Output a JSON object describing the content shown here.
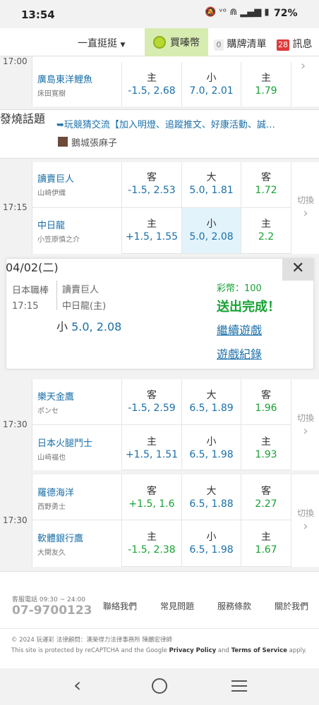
{
  "status": {
    "time": "13:54",
    "battery": "72%",
    "icons": "🔕 ᵛᵒ ⋒ ▂▄▆ ▮"
  },
  "nav": {
    "dropdown": "一直挺挺",
    "buy": "買嗪幣",
    "list_count": "0",
    "list": "購牌清單",
    "msg_count": "28",
    "msg": "訊息"
  },
  "games": [
    {
      "time": "17:00",
      "home": {
        "name": "廣島東洋鯉魚",
        "pitcher": "床田寛樹",
        "spread": {
          "side": "主",
          "line": "-1.5, 2.68"
        },
        "total": {
          "side": "小",
          "line": "7.0, 2.01"
        },
        "ml": {
          "side": "主",
          "line": "1.79"
        }
      }
    },
    {
      "time": "17:15",
      "away": {
        "name": "讀賣巨人",
        "pitcher": "山崎伊織",
        "spread": {
          "side": "客",
          "line": "-1.5, 2.53"
        },
        "total": {
          "side": "大",
          "line": "5.0, 1.81"
        },
        "ml": {
          "side": "客",
          "line": "1.72"
        }
      },
      "home": {
        "name": "中日龍",
        "pitcher": "小笠原慎之介",
        "spread": {
          "side": "主",
          "line": "+1.5, 1.55"
        },
        "total": {
          "side": "小",
          "line": "5.0, 2.08"
        },
        "ml": {
          "side": "主",
          "line": "2.2"
        }
      },
      "switch": "切換"
    },
    {
      "time": "17:30",
      "away": {
        "name": "樂天金鷹",
        "pitcher": "ポンセ",
        "spread": {
          "side": "客",
          "line": "-1.5, 2.59"
        },
        "total": {
          "side": "大",
          "line": "6.5, 1.89"
        },
        "ml": {
          "side": "客",
          "line": "1.96"
        }
      },
      "home": {
        "name": "日本火腿鬥士",
        "pitcher": "山﨑福也",
        "spread": {
          "side": "主",
          "line": "+1.5, 1.51"
        },
        "total": {
          "side": "小",
          "line": "6.5, 1.98"
        },
        "ml": {
          "side": "主",
          "line": "1.93"
        }
      },
      "switch": "切換"
    },
    {
      "time": "17:30",
      "away": {
        "name": "羅德海洋",
        "pitcher": "西野勇士",
        "spread": {
          "side": "客",
          "line": "+1.5, 1.6"
        },
        "total": {
          "side": "大",
          "line": "6.5, 1.88"
        },
        "ml": {
          "side": "客",
          "line": "2.27"
        }
      },
      "home": {
        "name": "軟體銀行鷹",
        "pitcher": "大関友久",
        "spread": {
          "side": "主",
          "line": "-1.5, 2.38"
        },
        "total": {
          "side": "小",
          "line": "6.5, 1.98"
        },
        "ml": {
          "side": "主",
          "line": "1.67"
        }
      },
      "switch": "切換"
    }
  ],
  "hot": {
    "label": "發燒話題",
    "title": "➥玩競猜交流【加入明燈、追蹤推文、好康活動、誠…",
    "author": "鵝城張麻子"
  },
  "popup": {
    "date": "04/02(二)",
    "league": "日本職棒",
    "time": "17:15",
    "team1": "讀賣巨人",
    "team2": "中日龍(主)",
    "pick_side": "小",
    "pick_value": "5.0, 2.08",
    "coins": "彩幣：100",
    "done": "送出完成！",
    "continue": "繼續遊戲",
    "record": "遊戲紀錄"
  },
  "footer": {
    "phone_label": "客服電話 09:30 ~ 24:00",
    "phone": "07-9700123",
    "links": [
      "聯絡我們",
      "常見問題",
      "服務條款",
      "關於我們"
    ],
    "copyright": "© 2024 玩運彩  法律顧問：漢榮得力法律事務所 陳鵬宏律師",
    "captcha_pre": "This site is protected by reCAPTCHA and the Google ",
    "privacy": "Privacy Policy",
    "and": " and ",
    "terms": "Terms of Service",
    "captcha_post": " apply."
  }
}
